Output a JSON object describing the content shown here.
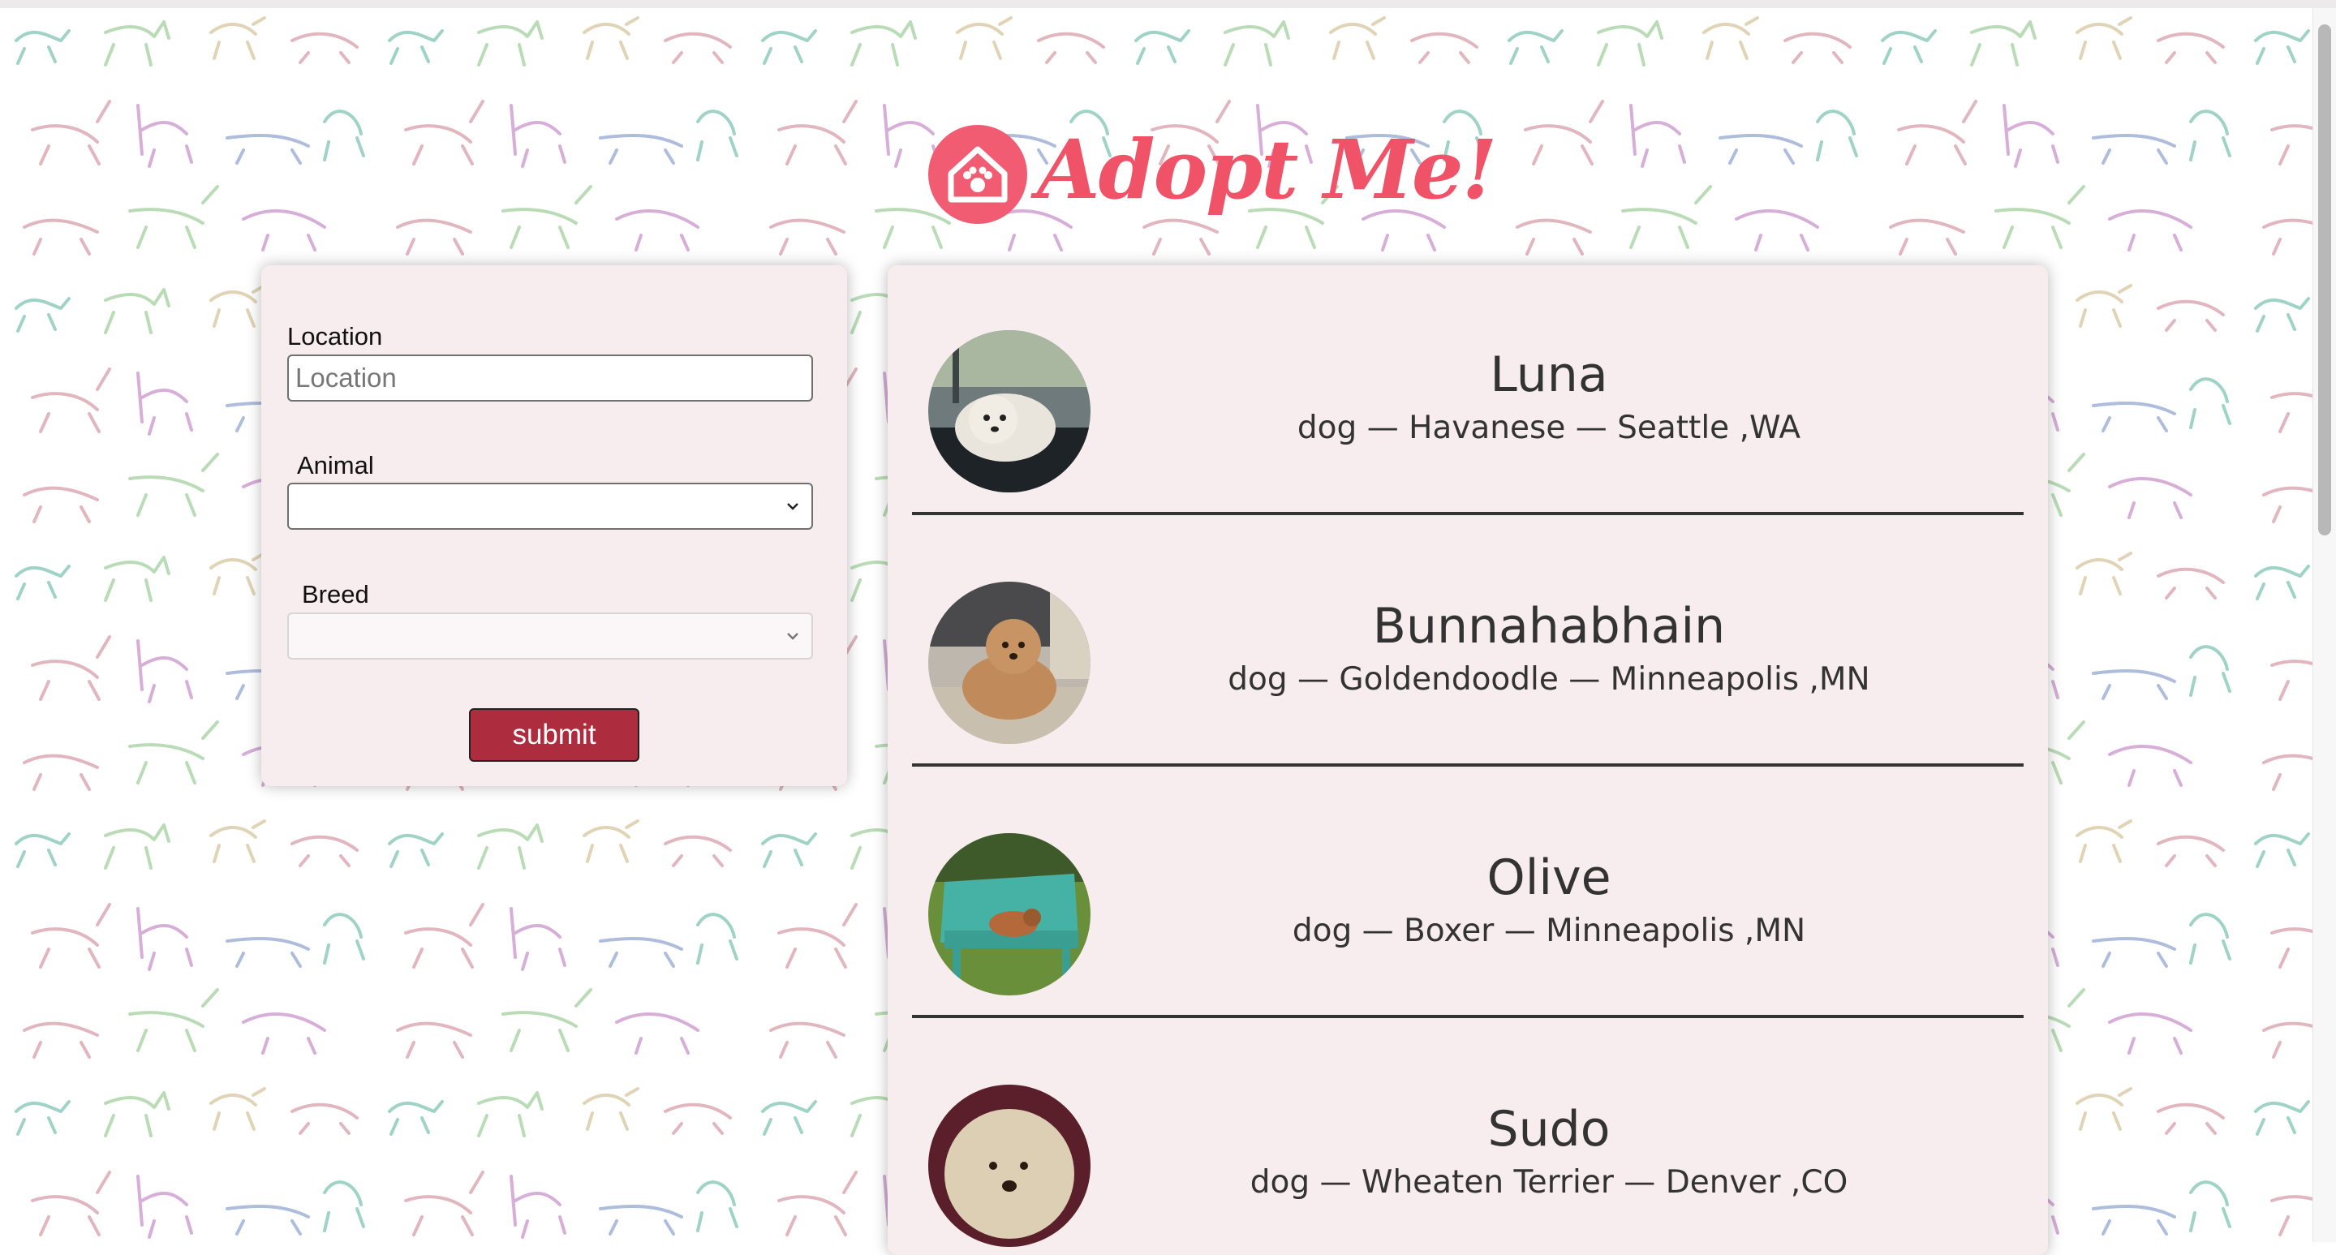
{
  "header": {
    "logo_text": "Adopt Me!"
  },
  "search": {
    "location_label": "Location",
    "location_placeholder": "Location",
    "location_value": "",
    "animal_label": "Animal",
    "animal_value": "",
    "breed_label": "Breed",
    "breed_value": "",
    "submit_label": "submit"
  },
  "pets": [
    {
      "name": "Luna",
      "info": "dog — Havanese — Seattle ,WA"
    },
    {
      "name": "Bunnahabhain",
      "info": "dog — Goldendoodle — Minneapolis ,MN"
    },
    {
      "name": "Olive",
      "info": "dog — Boxer — Minneapolis ,MN"
    },
    {
      "name": "Sudo",
      "info": "dog — Wheaten Terrier — Denver ,CO"
    }
  ],
  "colors": {
    "brand": "#f05368",
    "panel": "#f7ecee",
    "button": "#ad2c3e"
  }
}
